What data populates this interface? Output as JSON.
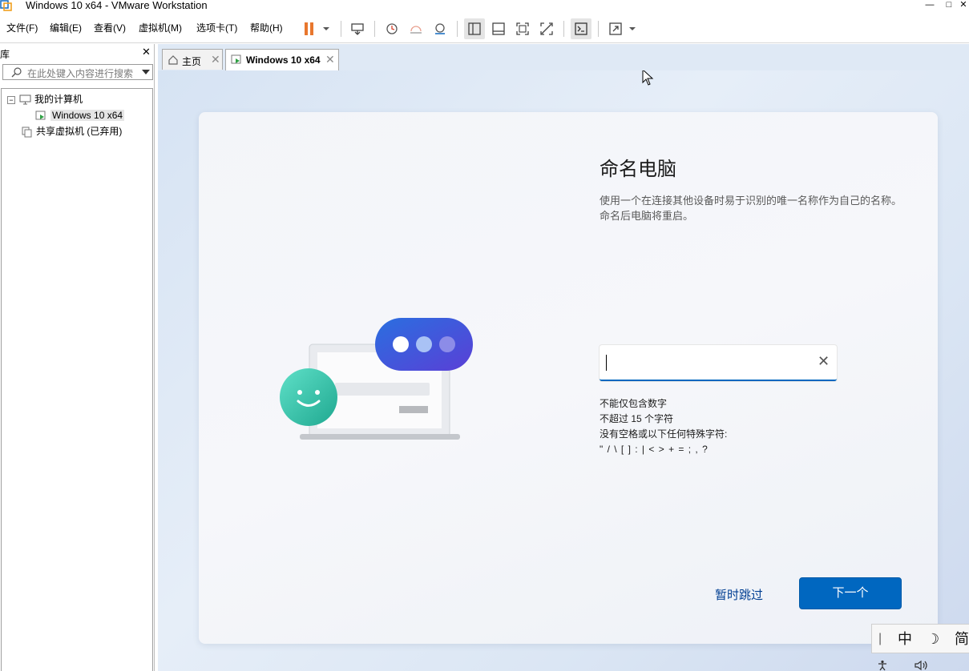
{
  "window": {
    "title": "Windows 10 x64 - VMware Workstation",
    "minimize": "—",
    "maximize": "□",
    "close": "✕"
  },
  "menu": [
    "文件(F)",
    "编辑(E)",
    "查看(V)",
    "虚拟机(M)",
    "选项卡(T)",
    "帮助(H)"
  ],
  "library": {
    "title": "库",
    "close": "✕",
    "search_placeholder": "在此处键入内容进行搜索",
    "tree": {
      "my_computer": "我的计算机",
      "vm": "Windows 10 x64",
      "shared": "共享虚拟机 (已弃用)",
      "expander": "−"
    }
  },
  "tabs": {
    "home": "主页",
    "vm": "Windows 10 x64",
    "close": "✕"
  },
  "oobe": {
    "title": "命名电脑",
    "description": "使用一个在连接其他设备时易于识别的唯一名称作为自己的名称。命名后电脑将重启。",
    "field_value": "",
    "clear": "✕",
    "rules": [
      "不能仅包含数字",
      "不超过 15 个字符",
      "没有空格或以下任何特殊字符:",
      "\" / \\ [ ] : | < > + = ; , ?"
    ],
    "skip": "暂时跳过",
    "next": "下一个"
  },
  "ime": {
    "sep": "|",
    "lang": "中",
    "mode": "☽",
    "script": "简"
  },
  "colors": {
    "accent": "#0067c0",
    "pause": "#e8772e"
  }
}
